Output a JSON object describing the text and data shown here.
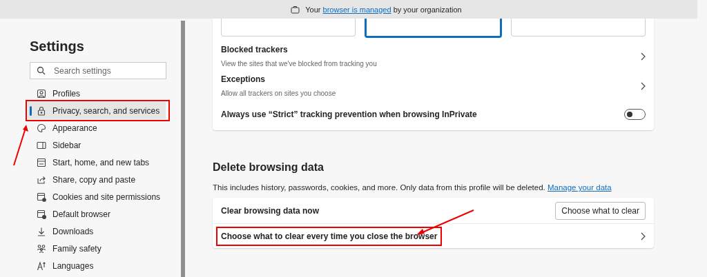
{
  "banner": {
    "before": "Your",
    "link": "browser is managed",
    "after": "by your organization"
  },
  "sidebar": {
    "title": "Settings",
    "search": {
      "placeholder": "Search settings"
    },
    "items": [
      {
        "label": "Profiles",
        "selected": false,
        "highlighted": false
      },
      {
        "label": "Privacy, search, and services",
        "selected": true,
        "highlighted": true
      },
      {
        "label": "Appearance",
        "selected": false,
        "highlighted": false
      },
      {
        "label": "Sidebar",
        "selected": false,
        "highlighted": false
      },
      {
        "label": "Start, home, and new tabs",
        "selected": false,
        "highlighted": false
      },
      {
        "label": "Share, copy and paste",
        "selected": false,
        "highlighted": false
      },
      {
        "label": "Cookies and site permissions",
        "selected": false,
        "highlighted": false
      },
      {
        "label": "Default browser",
        "selected": false,
        "highlighted": false
      },
      {
        "label": "Downloads",
        "selected": false,
        "highlighted": false
      },
      {
        "label": "Family safety",
        "selected": false,
        "highlighted": false
      },
      {
        "label": "Languages",
        "selected": false,
        "highlighted": false
      }
    ]
  },
  "tracking": {
    "cards": [
      {
        "selected": false
      },
      {
        "selected": true
      },
      {
        "selected": false
      }
    ],
    "rows": [
      {
        "kind": "link",
        "title": "Blocked trackers",
        "description": "View the sites that we've blocked from tracking you"
      },
      {
        "kind": "link",
        "title": "Exceptions",
        "description": "Allow all trackers on sites you choose"
      },
      {
        "kind": "toggle",
        "title": "Always use “Strict” tracking prevention when browsing InPrivate",
        "on": false
      }
    ]
  },
  "delete_data": {
    "heading": "Delete browsing data",
    "description": "This includes history, passwords, cookies, and more. Only data from this profile will be deleted.",
    "link": "Manage your data",
    "rows": [
      {
        "kind": "button",
        "title": "Clear browsing data now",
        "button": "Choose what to clear",
        "highlighted": false
      },
      {
        "kind": "link",
        "title": "Choose what to clear every time you close the browser",
        "highlighted": true
      }
    ]
  }
}
